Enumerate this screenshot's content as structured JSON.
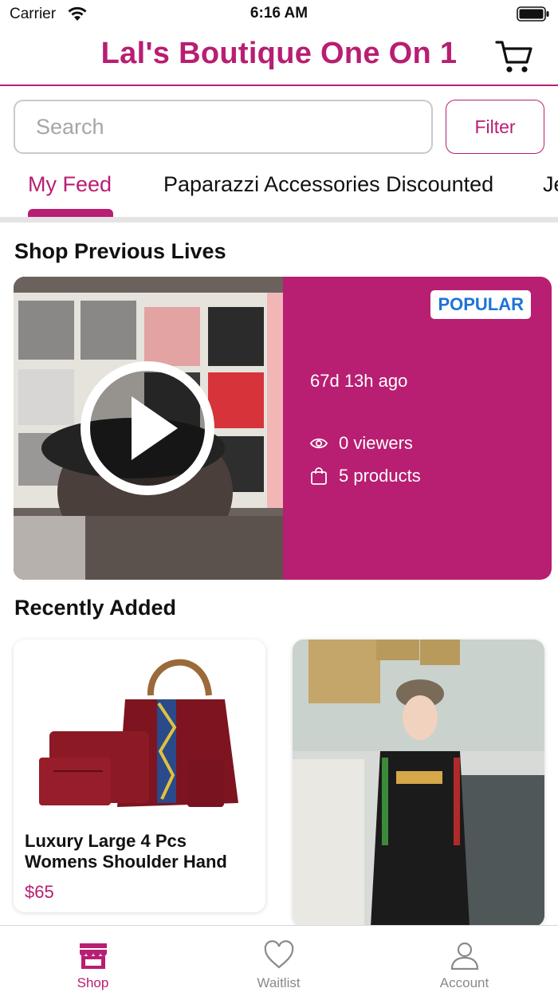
{
  "status_bar": {
    "carrier": "Carrier",
    "time": "6:16 AM"
  },
  "header": {
    "title": "Lal's Boutique One On 1"
  },
  "search": {
    "placeholder": "Search",
    "filter_label": "Filter"
  },
  "tabs": [
    {
      "label": "My Feed",
      "active": true
    },
    {
      "label": "Paparazzi Accessories Discounted",
      "active": false
    },
    {
      "label": "Je",
      "active": false
    }
  ],
  "previous_lives": {
    "section_title": "Shop Previous Lives",
    "card": {
      "badge": "POPULAR",
      "time_ago": "67d 13h ago",
      "viewers": "0 viewers",
      "products": "5 products"
    }
  },
  "recently_added": {
    "section_title": "Recently Added",
    "items": [
      {
        "title": "Luxury Large  4 Pcs Womens Shoulder Hand",
        "price": "$65"
      },
      {
        "title": "",
        "price": ""
      }
    ]
  },
  "tab_bar": [
    {
      "label": "Shop",
      "icon": "shop-icon",
      "active": true
    },
    {
      "label": "Waitlist",
      "icon": "heart-icon",
      "active": false
    },
    {
      "label": "Account",
      "icon": "person-icon",
      "active": false
    }
  ],
  "colors": {
    "brand": "#b81e72",
    "badge_text": "#1e73d8",
    "inactive": "#8a8a8a"
  }
}
